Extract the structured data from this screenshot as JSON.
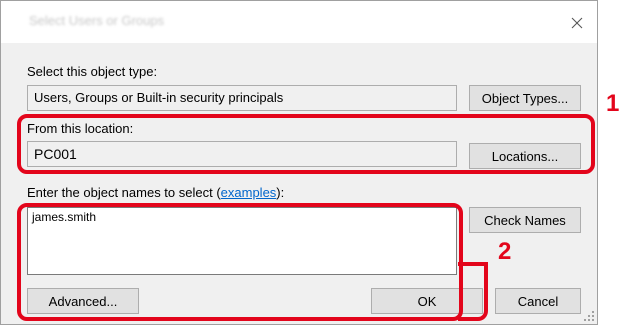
{
  "dialog": {
    "title": "Select Users or Groups"
  },
  "object_type": {
    "label": "Select this object type:",
    "value": "Users, Groups or Built-in security principals",
    "button": "Object Types..."
  },
  "location": {
    "label": "From this location:",
    "value": "PC001",
    "button": "Locations..."
  },
  "names": {
    "label_prefix": "Enter the object names to select (",
    "label_link": "examples",
    "label_suffix": "):",
    "value": "james.smith",
    "check_button": "Check Names"
  },
  "footer": {
    "advanced_button": "Advanced...",
    "ok_button": "OK",
    "cancel_button": "Cancel"
  },
  "callouts": {
    "one": "1",
    "two": "2"
  },
  "colors": {
    "callout": "#e3051b",
    "link": "#0066cc"
  },
  "icons": {
    "close": "close-icon",
    "resize": "resize-grip-icon"
  }
}
